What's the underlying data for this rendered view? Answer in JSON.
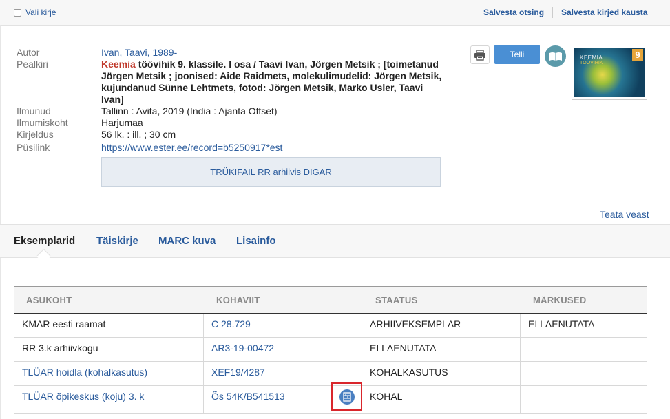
{
  "topbar": {
    "select_label": "Vali kirje",
    "save_search": "Salvesta otsing",
    "save_to_folder": "Salvesta kirjed kausta"
  },
  "record": {
    "labels": {
      "author": "Autor",
      "title": "Pealkiri",
      "published": "Ilmunud",
      "place": "Ilmumiskoht",
      "description": "Kirjeldus",
      "permalink": "Püsilink"
    },
    "author": "Ivan, Taavi, 1989-",
    "title_highlight": "Keemia",
    "title_rest": " töövihik 9. klassile. I osa / Taavi Ivan, Jörgen Metsik ; [toimetanud Jörgen Metsik ; joonised: Aide Raidmets, molekulimudelid: Jörgen Metsik, kujundanud Sünne Lehtmets, fotod: Jörgen Metsik, Marko Usler, Taavi Ivan]",
    "published": "Tallinn : Avita, 2019 (India : Ajanta Offset)",
    "place": "Harjumaa",
    "description": "56 lk. : ill. ; 30 cm",
    "permalink": "https://www.ester.ee/record=b5250917*est",
    "digar_button": "TRÜKIFAIL RR arhiivis DIGAR"
  },
  "actions": {
    "order_button": "Telli",
    "print_icon": "printer-icon",
    "read_icon": "open-book-icon"
  },
  "cover": {
    "title": "KEEMIA",
    "subtitle": "TÖÖVIHIK",
    "number": "9"
  },
  "report_error": "Teata veast",
  "tabs": [
    "Eksemplarid",
    "Täiskirje",
    "MARC kuva",
    "Lisainfo"
  ],
  "holdings": {
    "headers": [
      "ASUKOHT",
      "KOHAVIIT",
      "STAATUS",
      "MÄRKUSED"
    ],
    "rows": [
      {
        "location": "KMAR eesti raamat",
        "call_number": "C 28.729",
        "status": "ARHIIVEKSEMPLAR",
        "notes": "EI LAENUTATA"
      },
      {
        "location": "RR 3.k arhiivkogu",
        "call_number": "AR3-19-00472",
        "status": "EI LAENUTATA",
        "notes": ""
      },
      {
        "location": "TLÜAR hoidla (kohalkasutus)",
        "call_number": "XEF19/4287",
        "status": "KOHALKASUTUS",
        "notes": ""
      },
      {
        "location": "TLÜAR õpikeskus (koju) 3. k",
        "call_number": "Õs 54K/B541513",
        "status": "KOHAL",
        "notes": ""
      }
    ]
  },
  "colors": {
    "link": "#2a5b9c",
    "button": "#4a8fd4",
    "highlight": "#c0392b",
    "focus_box": "#d9262c"
  }
}
